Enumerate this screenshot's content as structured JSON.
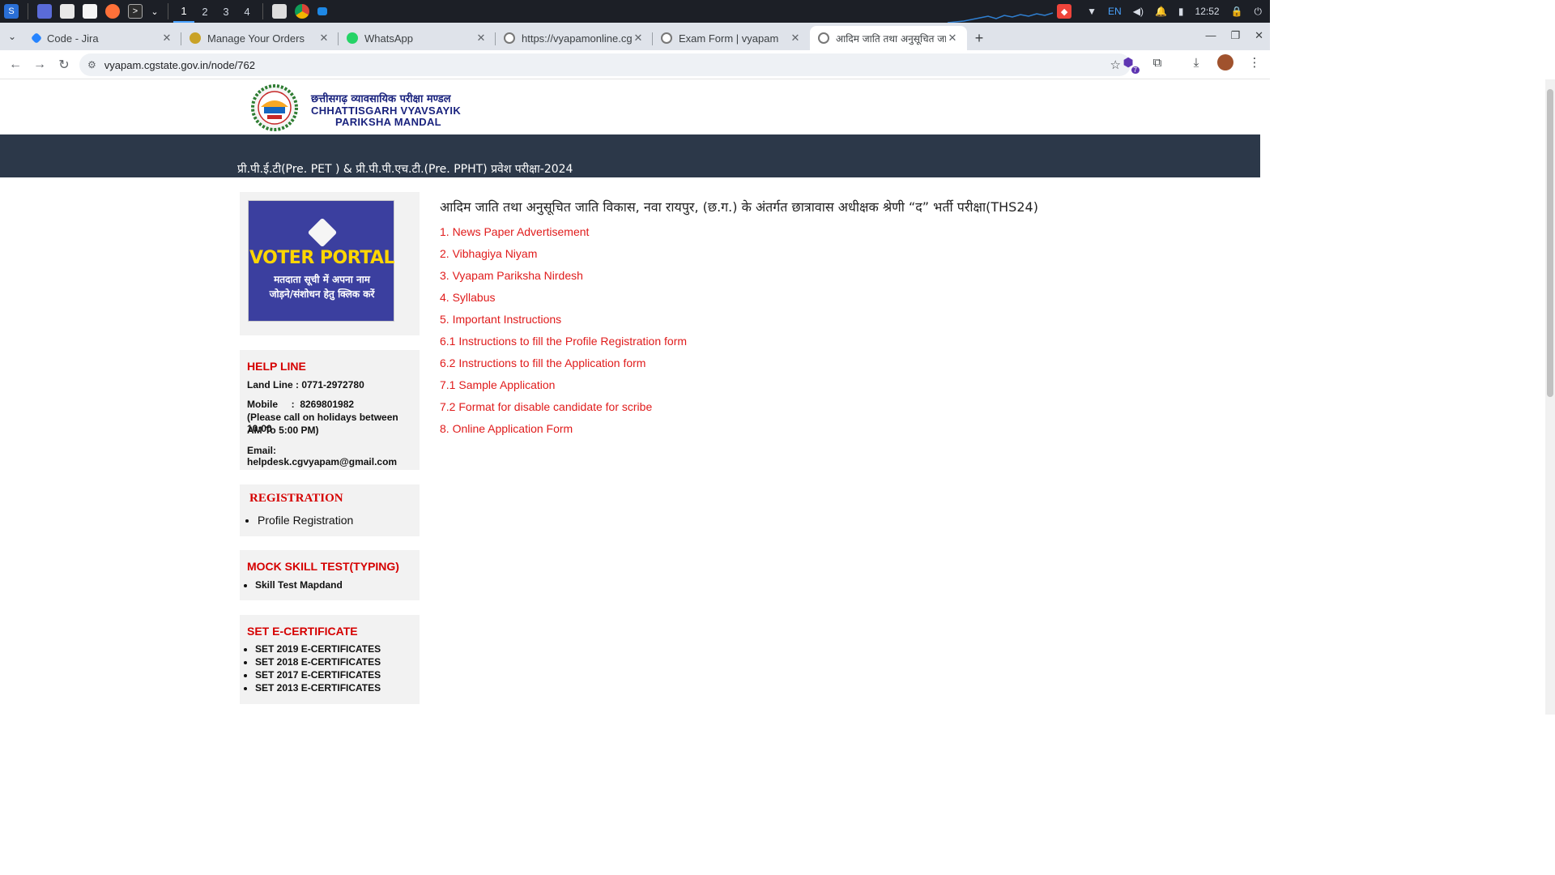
{
  "taskbar": {
    "workspaces": [
      "1",
      "2",
      "3",
      "4"
    ],
    "language": "EN",
    "clock": "12:52"
  },
  "tabs": [
    {
      "title": "Code - Jira",
      "favicon": "jira-icon"
    },
    {
      "title": "Manage Your Orders",
      "favicon": "cart-icon"
    },
    {
      "title": "WhatsApp",
      "favicon": "whatsapp-icon"
    },
    {
      "title": "https://vyapamonline.cg",
      "favicon": "globe-icon"
    },
    {
      "title": "Exam Form | vyapam",
      "favicon": "globe-icon"
    },
    {
      "title": "आदिम जाति तथा अनुसूचित जा",
      "favicon": "globe-icon"
    }
  ],
  "address_bar": {
    "url": "vyapam.cgstate.gov.in/node/762",
    "extensions_badge": "7"
  },
  "header": {
    "org_hindi": "छत्तीसगढ़ व्यावसायिक परीक्षा मण्डल",
    "org_english_line1": "CHHATTISGARH VYAVSAYIK",
    "org_english_line2": "PARIKSHA MANDAL",
    "banner": "प्री.पी.ई.टी(Pre. PET ) & प्री.पी.पी.एच.टी.(Pre. PPHT) प्रवेश परीक्षा-2024"
  },
  "sidebar": {
    "voter_portal": {
      "title": "VOTER PORTAL",
      "sub1": "मतदाता सूची में अपना नाम",
      "sub2": "जोड़ने/संशोधन हेतु क्लिक करें"
    },
    "helpline": {
      "title": "HELP LINE",
      "landline": "Land Line : 0771-2972780",
      "mobile": "Mobile     :  8269801982",
      "note1": "(Please call on holidays between 10:00",
      "note2": "AM To 5:00 PM)",
      "email": "Email:  helpdesk.cgvyapam@gmail.com"
    },
    "registration": {
      "title": "REGISTRATION",
      "items": [
        "Profile Registration"
      ]
    },
    "mock_test": {
      "title": "MOCK SKILL TEST(TYPING)",
      "items": [
        "Skill Test Mapdand"
      ]
    },
    "ecertificate": {
      "title": "SET E-CERTIFICATE",
      "items": [
        "SET 2019 E-CERTIFICATES",
        "SET 2018 E-CERTIFICATES",
        "SET 2017 E-CERTIFICATES",
        "SET 2013 E-CERTIFICATES"
      ]
    }
  },
  "main": {
    "title": "आदिम जाति तथा अनुसूचित जाति विकास, नवा रायपुर, (छ.ग.) के अंतर्गत छात्रावास अधीक्षक श्रेणी “द” भर्ती परीक्षा(THS24)",
    "links": [
      "1. News Paper Advertisement",
      "2. Vibhagiya Niyam",
      "3. Vyapam Pariksha Nirdesh",
      "4. Syllabus",
      "5. Important Instructions",
      "6.1 Instructions to fill the Profile Registration form",
      "6.2 Instructions to fill the Application form",
      "7.1 Sample Application",
      "7.2 Format for disable candidate for scribe",
      "8. Online Application Form"
    ]
  },
  "colors": {
    "banner_bg": "#2c3849",
    "link_red": "#e01b1b",
    "voter_bg": "#3b3f9f",
    "org_blue": "#1a237e"
  }
}
